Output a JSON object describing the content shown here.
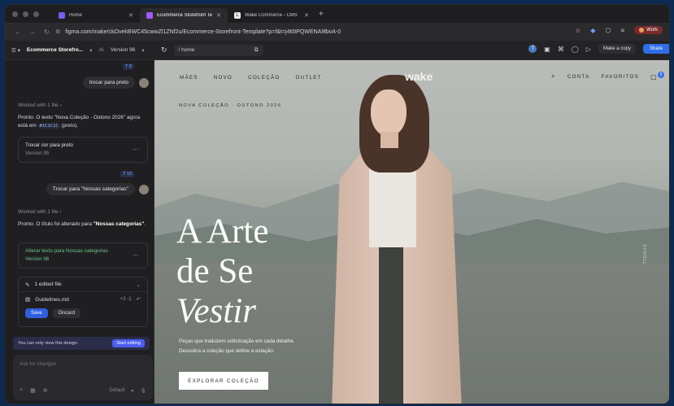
{
  "tabs": [
    {
      "label": "Home",
      "color": "#7a5cf0"
    },
    {
      "label": "Ecommerce Storefront Temp",
      "color": "#a259ff",
      "active": true
    },
    {
      "label": "Wake Commerce - CMS",
      "color": "#333333"
    }
  ],
  "address": {
    "url": "figma.com/make/ckOvekBWC45cwwZl1ZNf2u/Ecommerce-Storefront-Template?p=f&t=j4t0tPQWENA9lbvA-0",
    "profile_label": "Work"
  },
  "figma": {
    "file_name": "Ecommerce Storefro...",
    "ai_label": "AI",
    "version_label": "Version 96",
    "path": "/ home",
    "avatar_letter": "T",
    "make_copy_label": "Make a copy",
    "share_label": "Share"
  },
  "chat": {
    "msg1_tag": "T 8",
    "msg1": "trocar para preto",
    "worked1": "Worked with 1 file  ›",
    "resp1_a": "Pronto. O texto \"Nova Coleção - Outono 2026\" agora está em ",
    "resp1_code": "#1C1C1C",
    "resp1_b": " (preto).",
    "ver1_title": "Trocar cor para preto",
    "ver1_sub": "Version 95",
    "msg2_tag": "T 10",
    "msg2": "Trocar para \"Nossas categorias\"",
    "worked2": "Worked with 1 file  ›",
    "resp2_a": "Pronto. O título foi alterado para ",
    "resp2_b": "\"Nossas categorias\"",
    "resp2_c": ".",
    "ver2_title": "Alterar texto para Nossas categorias",
    "ver2_sub": "Version 96",
    "edited_label": "1 edited file",
    "file_name": "Guidelines.md",
    "file_diff": "+2 -1",
    "save_label": "Save",
    "discard_label": "Discard",
    "view_only": "You can only view this design.",
    "start_editing": "Start editing",
    "ask_placeholder": "Ask for changes",
    "model_label": "Default"
  },
  "site": {
    "nav": [
      "MÃES",
      "NOVO",
      "COLEÇÃO",
      "OUTLET"
    ],
    "brand": "wake",
    "account": "CONTA",
    "favorites": "FAVORITOS",
    "cart_count": "0",
    "eyebrow": "NOVA COLEÇÃO · OUTONO 2026",
    "headline_1": "A Arte",
    "headline_2": "de Se",
    "headline_3": "Vestir",
    "subcopy_1": "Peças que traduzem sofisticação em cada detalhe.",
    "subcopy_2": "Descubra a coleção que define a estação.",
    "cta": "EXPLORAR COLEÇÃO",
    "side_tag": "SCROLL"
  }
}
